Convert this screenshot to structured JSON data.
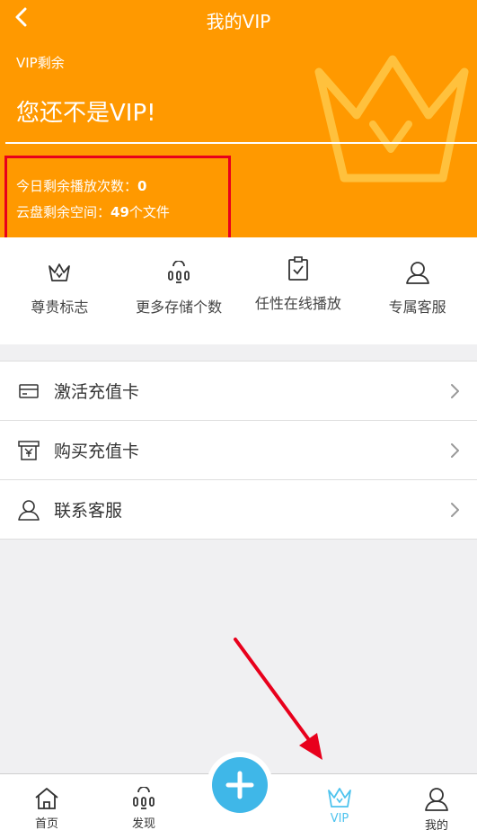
{
  "header": {
    "title": "我的VIP",
    "vip_label": "VIP剩余",
    "status": "您还不是VIP!",
    "plays_label": "今日剩余播放次数：",
    "plays_value": "0",
    "storage_label": "云盘剩余空间：",
    "storage_value": "49",
    "storage_unit": "个文件",
    "bg_color": "#ff9900"
  },
  "features": [
    {
      "label": "尊贵标志",
      "icon": "crown-icon"
    },
    {
      "label": "更多存储个数",
      "icon": "storage-icon"
    },
    {
      "label": "任性在线播放",
      "icon": "clipboard-check-icon"
    },
    {
      "label": "专属客服",
      "icon": "user-icon"
    }
  ],
  "menu": [
    {
      "label": "激活充值卡",
      "icon": "card-icon"
    },
    {
      "label": "购买充值卡",
      "icon": "purchase-icon"
    },
    {
      "label": "联系客服",
      "icon": "user-icon"
    }
  ],
  "tabbar": {
    "tabs": [
      {
        "label": "首页",
        "icon": "home-icon"
      },
      {
        "label": "发现",
        "icon": "discover-icon"
      },
      {
        "label": "VIP",
        "icon": "crown-icon",
        "active": true
      },
      {
        "label": "我的",
        "icon": "user-icon"
      }
    ],
    "add_icon": "plus-icon",
    "active_color": "#4ec3ee"
  }
}
